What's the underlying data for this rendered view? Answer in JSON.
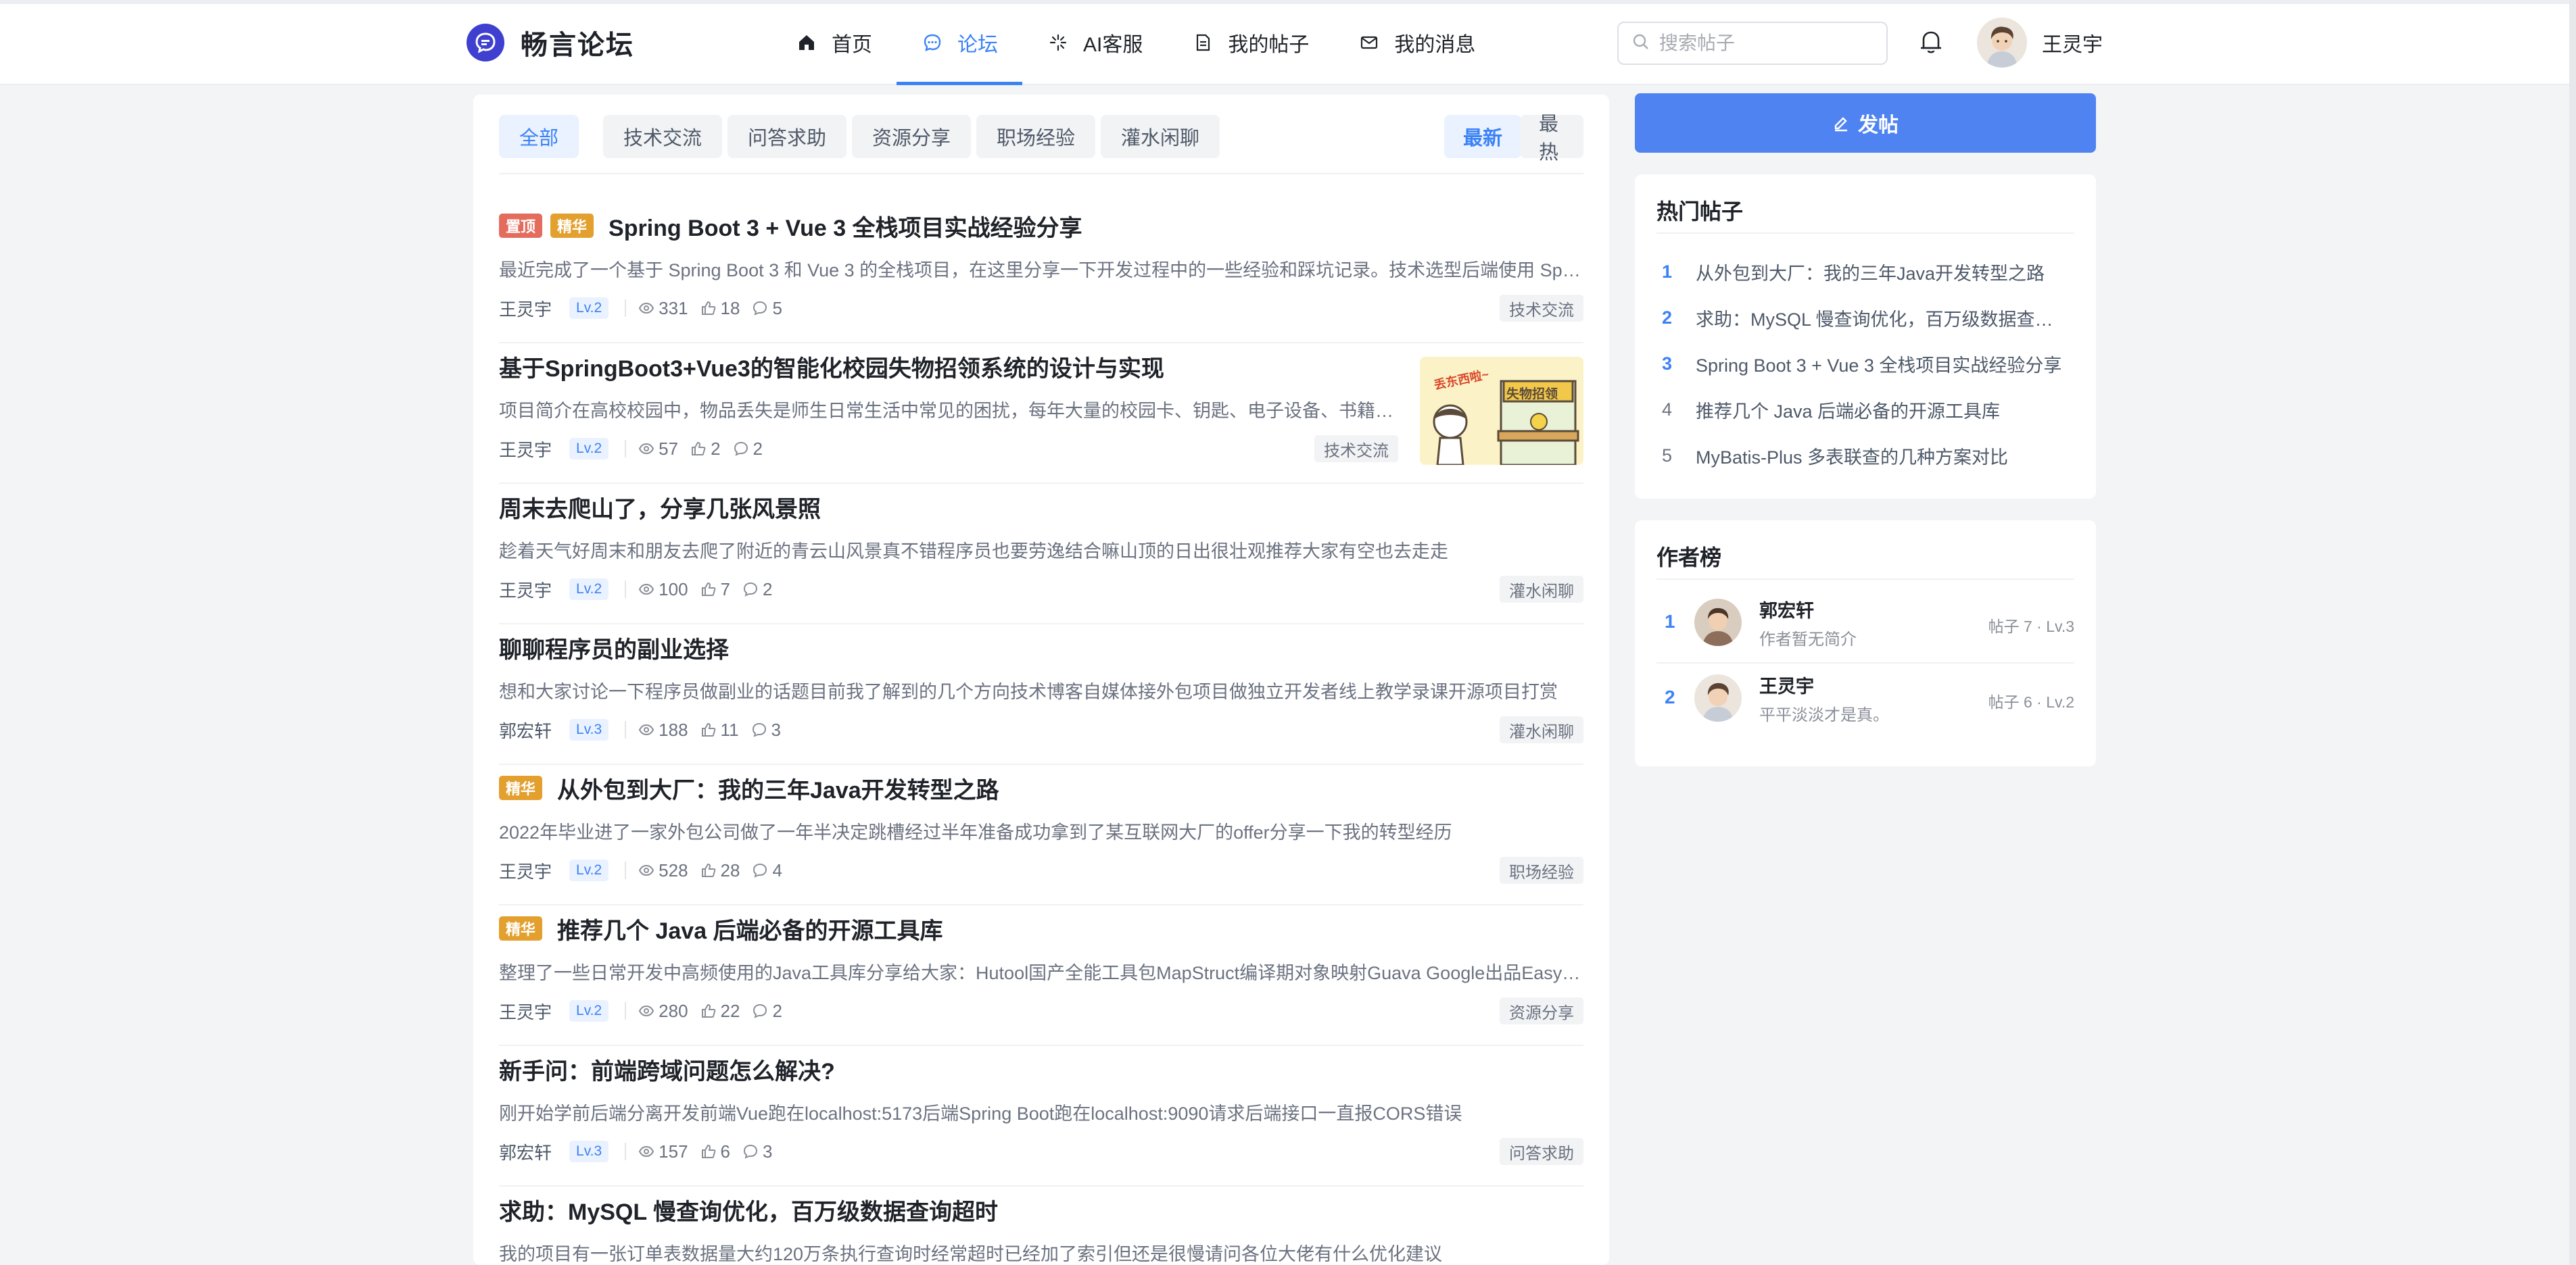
{
  "app": {
    "name": "畅言论坛"
  },
  "nav": {
    "items": [
      {
        "label": "首页",
        "icon": "home-icon",
        "active": false
      },
      {
        "label": "论坛",
        "icon": "chat-bubble-icon",
        "active": true
      },
      {
        "label": "AI客服",
        "icon": "sparkle-icon",
        "active": false
      },
      {
        "label": "我的帖子",
        "icon": "document-icon",
        "active": false
      },
      {
        "label": "我的消息",
        "icon": "mail-icon",
        "active": false
      }
    ]
  },
  "search": {
    "placeholder": "搜索帖子",
    "value": ""
  },
  "user": {
    "name": "王灵宇"
  },
  "filters": {
    "categories": [
      "全部",
      "技术交流",
      "问答求助",
      "资源分享",
      "职场经验",
      "灌水闲聊"
    ],
    "active_category": "全部",
    "sorts": [
      "最新",
      "最热"
    ],
    "active_sort": "最新"
  },
  "posts": [
    {
      "tags": [
        "置顶",
        "精华"
      ],
      "title": "Spring Boot 3 + Vue 3 全栈项目实战经验分享",
      "excerpt": "最近完成了一个基于 Spring Boot 3 和 Vue 3 的全栈项目，在这里分享一下开发过程中的一些经验和踩坑记录。技术选型后端使用 Sprin...",
      "author": "王灵宇",
      "level": "Lv.2",
      "views": "331",
      "likes": "18",
      "comments": "5",
      "category": "技术交流",
      "has_thumb": false
    },
    {
      "tags": [],
      "title": "基于SpringBoot3+Vue3的智能化校园失物招领系统的设计与实现",
      "excerpt": "项目简介在高校校园中，物品丢失是师生日常生活中常见的困扰，每年大量的校园卡、钥匙、电子设备、书籍等物...",
      "author": "王灵宇",
      "level": "Lv.2",
      "views": "57",
      "likes": "2",
      "comments": "2",
      "category": "技术交流",
      "has_thumb": true,
      "thumb_text": "失物招领",
      "thumb_text2": "丢东西啦~"
    },
    {
      "tags": [],
      "title": "周末去爬山了，分享几张风景照",
      "excerpt": "趁着天气好周末和朋友去爬了附近的青云山风景真不错程序员也要劳逸结合嘛山顶的日出很壮观推荐大家有空也去走走",
      "author": "王灵宇",
      "level": "Lv.2",
      "views": "100",
      "likes": "7",
      "comments": "2",
      "category": "灌水闲聊",
      "has_thumb": false
    },
    {
      "tags": [],
      "title": "聊聊程序员的副业选择",
      "excerpt": "想和大家讨论一下程序员做副业的话题目前我了解到的几个方向技术博客自媒体接外包项目做独立开发者线上教学录课开源项目打赏",
      "author": "郭宏轩",
      "level": "Lv.3",
      "views": "188",
      "likes": "11",
      "comments": "3",
      "category": "灌水闲聊",
      "has_thumb": false
    },
    {
      "tags": [
        "精华"
      ],
      "title": "从外包到大厂：我的三年Java开发转型之路",
      "excerpt": "2022年毕业进了一家外包公司做了一年半决定跳槽经过半年准备成功拿到了某互联网大厂的offer分享一下我的转型经历",
      "author": "王灵宇",
      "level": "Lv.2",
      "views": "528",
      "likes": "28",
      "comments": "4",
      "category": "职场经验",
      "has_thumb": false
    },
    {
      "tags": [
        "精华"
      ],
      "title": "推荐几个 Java 后端必备的开源工具库",
      "excerpt": "整理了一些日常开发中高频使用的Java工具库分享给大家：Hutool国产全能工具包MapStruct编译期对象映射Guava Google出品EasyExc...",
      "author": "王灵宇",
      "level": "Lv.2",
      "views": "280",
      "likes": "22",
      "comments": "2",
      "category": "资源分享",
      "has_thumb": false
    },
    {
      "tags": [],
      "title": "新手问：前端跨域问题怎么解决?",
      "excerpt": "刚开始学前后端分离开发前端Vue跑在localhost:5173后端Spring Boot跑在localhost:9090请求后端接口一直报CORS错误",
      "author": "郭宏轩",
      "level": "Lv.3",
      "views": "157",
      "likes": "6",
      "comments": "3",
      "category": "问答求助",
      "has_thumb": false
    },
    {
      "tags": [],
      "title": "求助：MySQL 慢查询优化，百万级数据查询超时",
      "excerpt": "我的项目有一张订单表数据量大约120万条执行查询时经常超时已经加了索引但还是很慢请问各位大佬有什么优化建议",
      "author": "",
      "level": "",
      "views": "",
      "likes": "",
      "comments": "",
      "category": "",
      "has_thumb": false
    }
  ],
  "sidebar": {
    "publish_label": "发帖",
    "hot": {
      "title": "热门帖子",
      "items": [
        {
          "rank": "1",
          "title": "从外包到大厂：我的三年Java开发转型之路"
        },
        {
          "rank": "2",
          "title": "求助：MySQL 慢查询优化，百万级数据查询..."
        },
        {
          "rank": "3",
          "title": "Spring Boot 3 + Vue 3 全栈项目实战经验分享"
        },
        {
          "rank": "4",
          "title": "推荐几个 Java 后端必备的开源工具库"
        },
        {
          "rank": "5",
          "title": "MyBatis-Plus 多表联查的几种方案对比"
        }
      ]
    },
    "authors": {
      "title": "作者榜",
      "items": [
        {
          "rank": "1",
          "name": "郭宏轩",
          "bio": "作者暂无简介",
          "stats": "帖子 7 · Lv.3"
        },
        {
          "rank": "2",
          "name": "王灵宇",
          "bio": "平平淡淡才是真。",
          "stats": "帖子 6 · Lv.2"
        }
      ]
    }
  },
  "colors": {
    "accent": "#3b82f6",
    "pin_tag": "#e46c5c",
    "essence_tag": "#e3a02f",
    "logo": "#3f3fd0"
  }
}
